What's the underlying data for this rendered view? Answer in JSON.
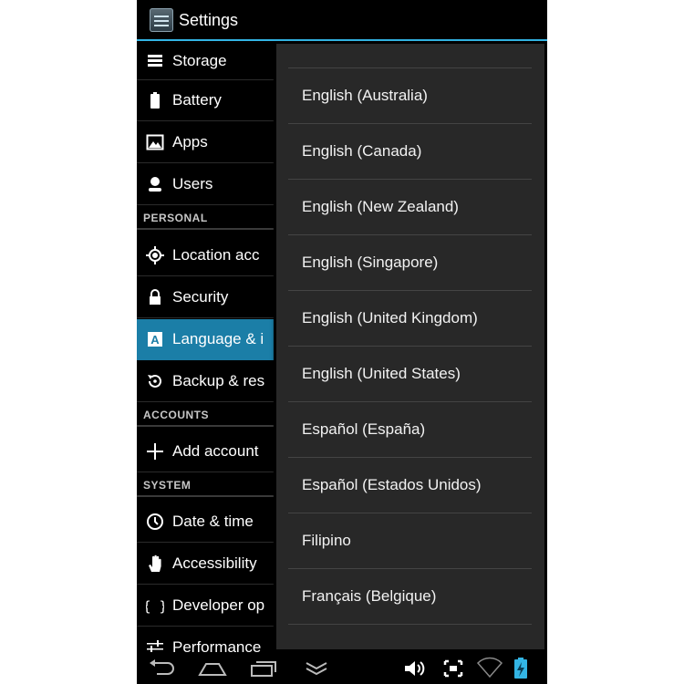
{
  "action_bar": {
    "title": "Settings",
    "icon": "settings-app-icon"
  },
  "sidebar": {
    "items": [
      {
        "label": "Storage",
        "icon": "storage-icon"
      },
      {
        "label": "Battery",
        "icon": "battery-icon"
      },
      {
        "label": "Apps",
        "icon": "apps-icon"
      },
      {
        "label": "Users",
        "icon": "users-icon"
      },
      {
        "label": "Location acc",
        "icon": "location-icon"
      },
      {
        "label": "Security",
        "icon": "lock-icon"
      },
      {
        "label": "Language & i",
        "icon": "language-icon"
      },
      {
        "label": "Backup & res",
        "icon": "backup-icon"
      },
      {
        "label": "Add account",
        "icon": "plus-icon"
      },
      {
        "label": "Date & time",
        "icon": "clock-icon"
      },
      {
        "label": "Accessibility",
        "icon": "hand-icon"
      },
      {
        "label": "Developer op",
        "icon": "braces-icon"
      },
      {
        "label": "Performance",
        "icon": "sliders-icon"
      }
    ],
    "headers": {
      "personal": "PERSONAL",
      "accounts": "ACCOUNTS",
      "system": "SYSTEM"
    },
    "active_item": "Language & i"
  },
  "language_list": {
    "items": [
      "English (Australia)",
      "English (Canada)",
      "English (New Zealand)",
      "English (Singapore)",
      "English (United Kingdom)",
      "English (United States)",
      "Español (España)",
      "Español (Estados Unidos)",
      "Filipino",
      "Français (Belgique)"
    ]
  },
  "nav_bar": {
    "buttons": [
      "back-icon",
      "home-icon",
      "recent-apps-icon",
      "hide-keyboard-icon"
    ],
    "status_icons": [
      "volume-icon",
      "screenshot-icon",
      "wifi-icon",
      "battery-charging-icon"
    ]
  },
  "colors": {
    "accent": "#33b5e5",
    "active_item": "#1b7ea7",
    "dropdown_bg": "#282828"
  }
}
